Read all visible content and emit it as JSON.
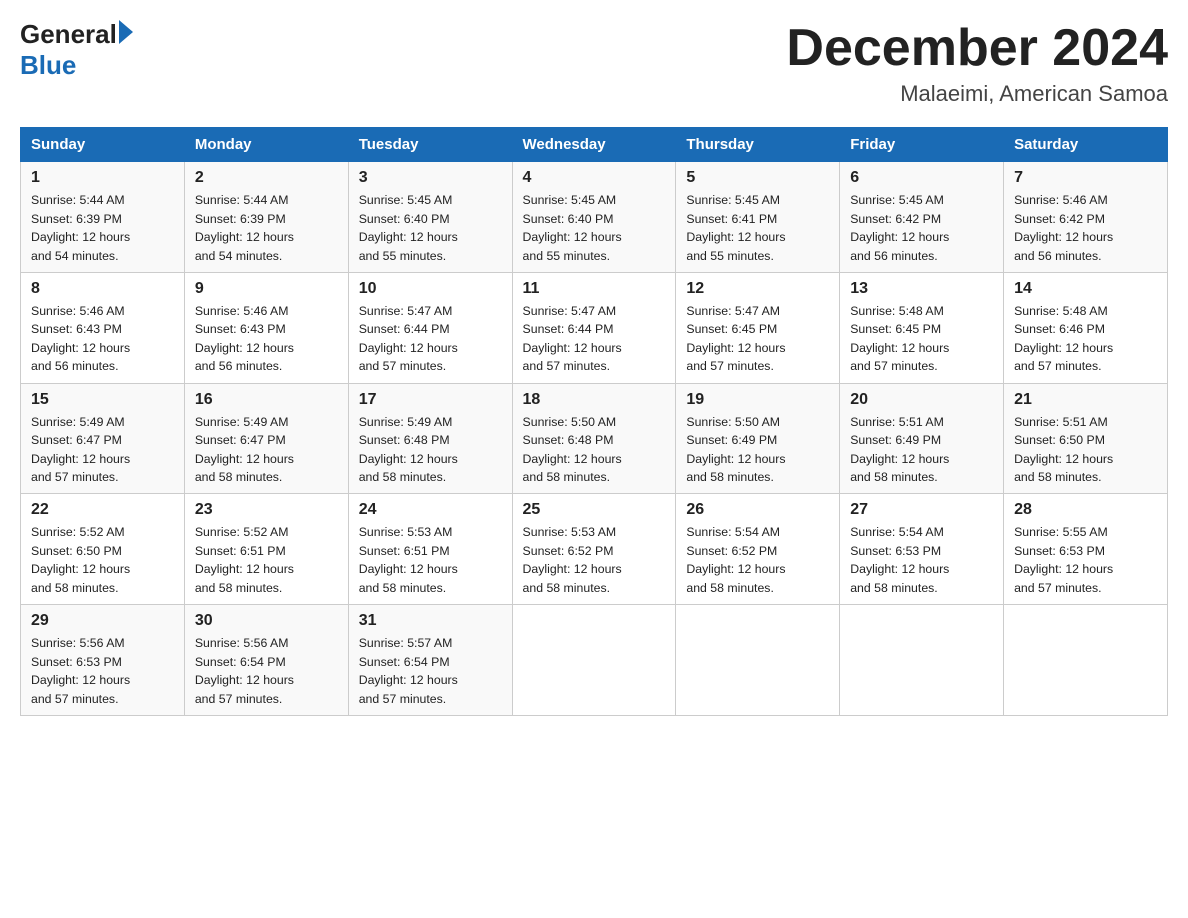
{
  "header": {
    "logo_text": "General",
    "logo_blue": "Blue",
    "month_title": "December 2024",
    "location": "Malaeimi, American Samoa"
  },
  "days_of_week": [
    "Sunday",
    "Monday",
    "Tuesday",
    "Wednesday",
    "Thursday",
    "Friday",
    "Saturday"
  ],
  "weeks": [
    [
      {
        "day": "1",
        "sunrise": "5:44 AM",
        "sunset": "6:39 PM",
        "daylight": "12 hours and 54 minutes."
      },
      {
        "day": "2",
        "sunrise": "5:44 AM",
        "sunset": "6:39 PM",
        "daylight": "12 hours and 54 minutes."
      },
      {
        "day": "3",
        "sunrise": "5:45 AM",
        "sunset": "6:40 PM",
        "daylight": "12 hours and 55 minutes."
      },
      {
        "day": "4",
        "sunrise": "5:45 AM",
        "sunset": "6:40 PM",
        "daylight": "12 hours and 55 minutes."
      },
      {
        "day": "5",
        "sunrise": "5:45 AM",
        "sunset": "6:41 PM",
        "daylight": "12 hours and 55 minutes."
      },
      {
        "day": "6",
        "sunrise": "5:45 AM",
        "sunset": "6:42 PM",
        "daylight": "12 hours and 56 minutes."
      },
      {
        "day": "7",
        "sunrise": "5:46 AM",
        "sunset": "6:42 PM",
        "daylight": "12 hours and 56 minutes."
      }
    ],
    [
      {
        "day": "8",
        "sunrise": "5:46 AM",
        "sunset": "6:43 PM",
        "daylight": "12 hours and 56 minutes."
      },
      {
        "day": "9",
        "sunrise": "5:46 AM",
        "sunset": "6:43 PM",
        "daylight": "12 hours and 56 minutes."
      },
      {
        "day": "10",
        "sunrise": "5:47 AM",
        "sunset": "6:44 PM",
        "daylight": "12 hours and 57 minutes."
      },
      {
        "day": "11",
        "sunrise": "5:47 AM",
        "sunset": "6:44 PM",
        "daylight": "12 hours and 57 minutes."
      },
      {
        "day": "12",
        "sunrise": "5:47 AM",
        "sunset": "6:45 PM",
        "daylight": "12 hours and 57 minutes."
      },
      {
        "day": "13",
        "sunrise": "5:48 AM",
        "sunset": "6:45 PM",
        "daylight": "12 hours and 57 minutes."
      },
      {
        "day": "14",
        "sunrise": "5:48 AM",
        "sunset": "6:46 PM",
        "daylight": "12 hours and 57 minutes."
      }
    ],
    [
      {
        "day": "15",
        "sunrise": "5:49 AM",
        "sunset": "6:47 PM",
        "daylight": "12 hours and 57 minutes."
      },
      {
        "day": "16",
        "sunrise": "5:49 AM",
        "sunset": "6:47 PM",
        "daylight": "12 hours and 58 minutes."
      },
      {
        "day": "17",
        "sunrise": "5:49 AM",
        "sunset": "6:48 PM",
        "daylight": "12 hours and 58 minutes."
      },
      {
        "day": "18",
        "sunrise": "5:50 AM",
        "sunset": "6:48 PM",
        "daylight": "12 hours and 58 minutes."
      },
      {
        "day": "19",
        "sunrise": "5:50 AM",
        "sunset": "6:49 PM",
        "daylight": "12 hours and 58 minutes."
      },
      {
        "day": "20",
        "sunrise": "5:51 AM",
        "sunset": "6:49 PM",
        "daylight": "12 hours and 58 minutes."
      },
      {
        "day": "21",
        "sunrise": "5:51 AM",
        "sunset": "6:50 PM",
        "daylight": "12 hours and 58 minutes."
      }
    ],
    [
      {
        "day": "22",
        "sunrise": "5:52 AM",
        "sunset": "6:50 PM",
        "daylight": "12 hours and 58 minutes."
      },
      {
        "day": "23",
        "sunrise": "5:52 AM",
        "sunset": "6:51 PM",
        "daylight": "12 hours and 58 minutes."
      },
      {
        "day": "24",
        "sunrise": "5:53 AM",
        "sunset": "6:51 PM",
        "daylight": "12 hours and 58 minutes."
      },
      {
        "day": "25",
        "sunrise": "5:53 AM",
        "sunset": "6:52 PM",
        "daylight": "12 hours and 58 minutes."
      },
      {
        "day": "26",
        "sunrise": "5:54 AM",
        "sunset": "6:52 PM",
        "daylight": "12 hours and 58 minutes."
      },
      {
        "day": "27",
        "sunrise": "5:54 AM",
        "sunset": "6:53 PM",
        "daylight": "12 hours and 58 minutes."
      },
      {
        "day": "28",
        "sunrise": "5:55 AM",
        "sunset": "6:53 PM",
        "daylight": "12 hours and 57 minutes."
      }
    ],
    [
      {
        "day": "29",
        "sunrise": "5:56 AM",
        "sunset": "6:53 PM",
        "daylight": "12 hours and 57 minutes."
      },
      {
        "day": "30",
        "sunrise": "5:56 AM",
        "sunset": "6:54 PM",
        "daylight": "12 hours and 57 minutes."
      },
      {
        "day": "31",
        "sunrise": "5:57 AM",
        "sunset": "6:54 PM",
        "daylight": "12 hours and 57 minutes."
      },
      null,
      null,
      null,
      null
    ]
  ],
  "labels": {
    "sunrise": "Sunrise:",
    "sunset": "Sunset:",
    "daylight": "Daylight:"
  }
}
